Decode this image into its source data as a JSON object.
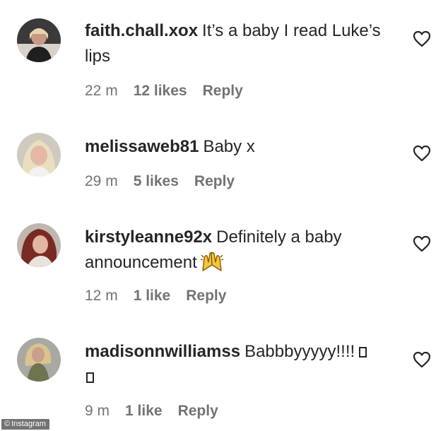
{
  "comments": [
    {
      "username": "faith.chall.xox",
      "text": "It’s a baby I read Luke’s lips",
      "time": "22 m",
      "likes": "12 likes",
      "reply": "Reply"
    },
    {
      "username": "melissaweb81",
      "text": "Baby x",
      "time": "29 m",
      "likes": "5 likes",
      "reply": "Reply"
    },
    {
      "username": "kirstyleanne92x",
      "text": "Definitely a baby announcement",
      "time": "12 m",
      "likes": "1 like",
      "reply": "Reply"
    },
    {
      "username": "madisonnwilliamss",
      "text": "Babbbyyyyy!!!!",
      "time": "9 m",
      "likes": "1 like",
      "reply": "Reply"
    }
  ],
  "watermark": {
    "symbol": "©",
    "label": "Instagram"
  },
  "colors": {
    "text": "#262626",
    "meta": "#737373",
    "background": "#ffffff"
  },
  "icons": {
    "like": "heart-outline-icon",
    "emoji": "raising-hands-emoji"
  }
}
